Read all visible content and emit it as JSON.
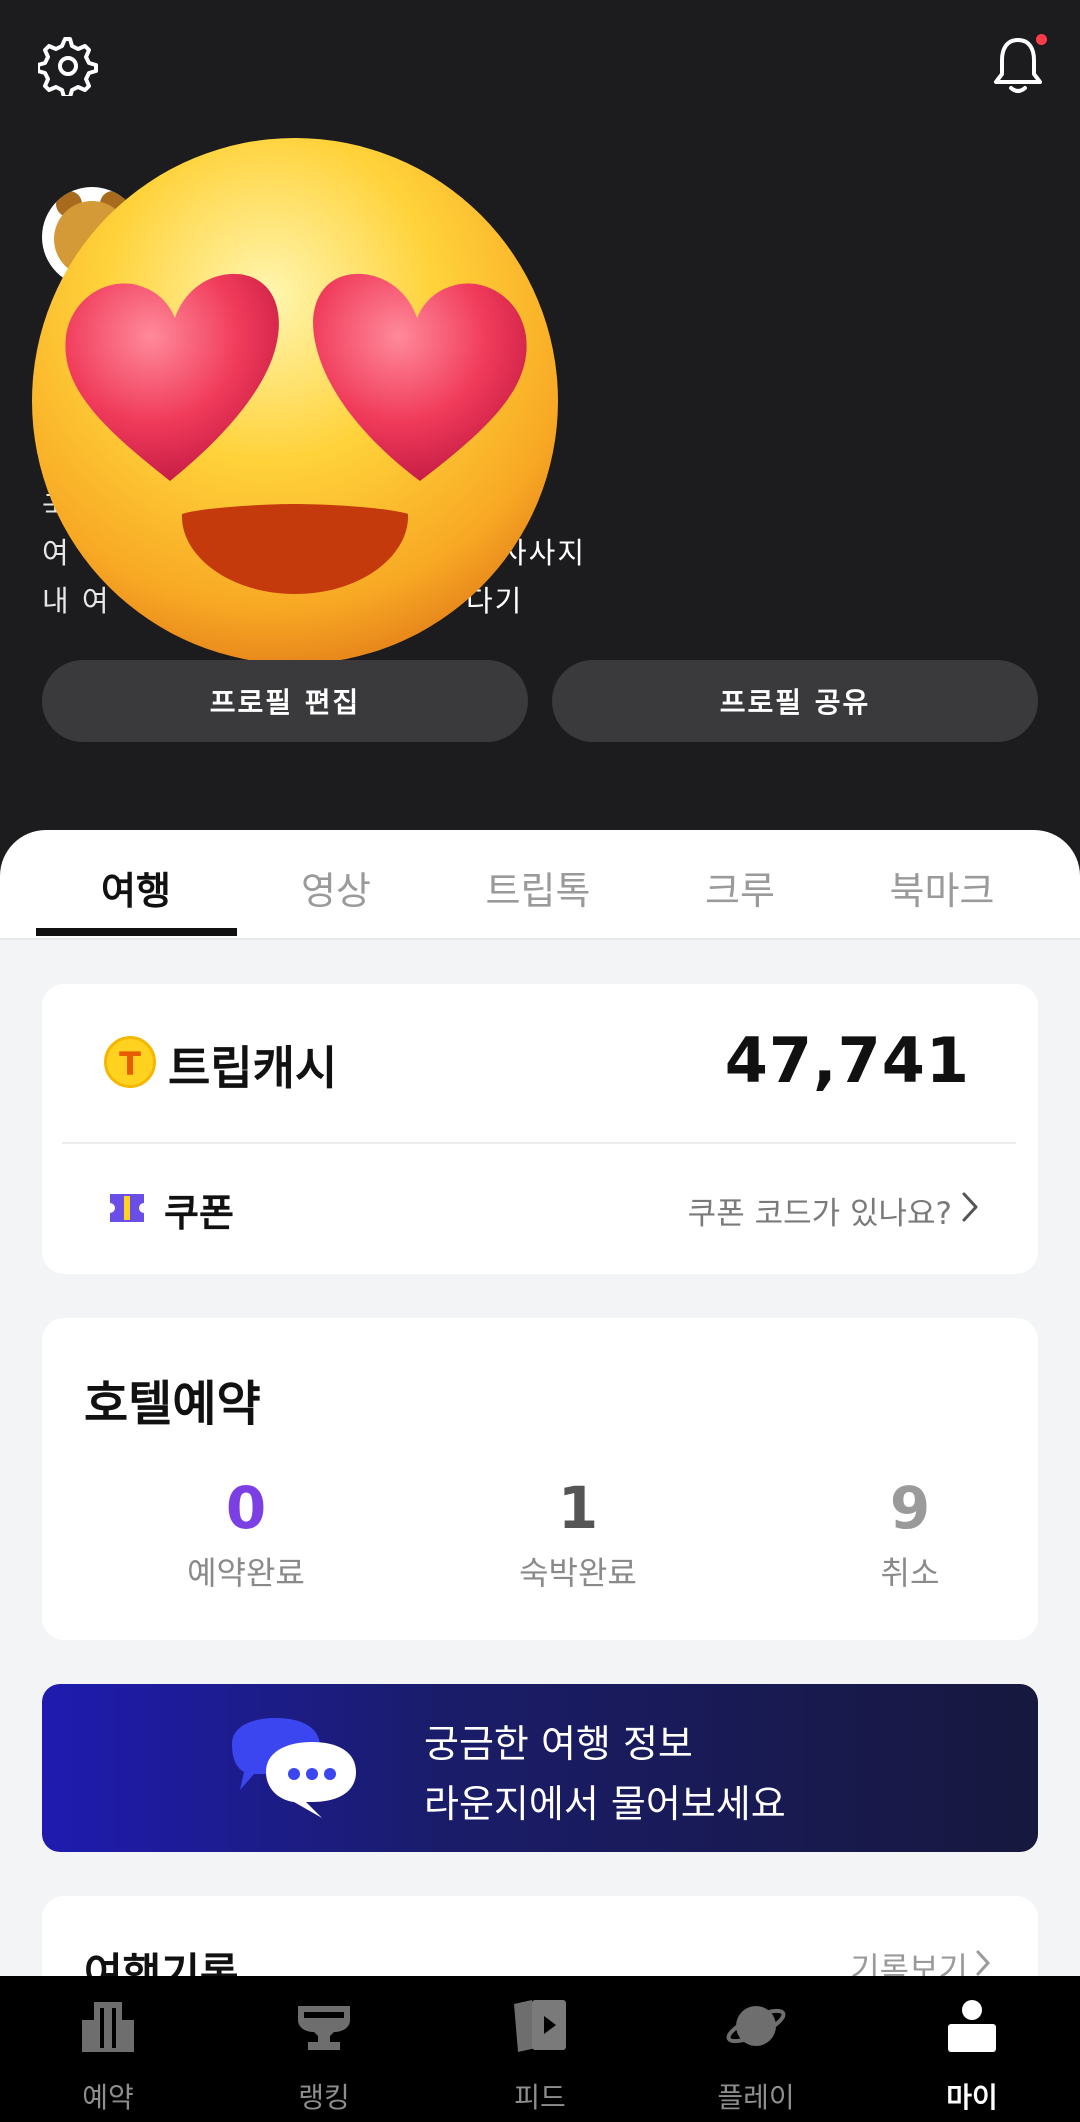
{
  "profile": {
    "bio_line1": "국",
    "bio_line2": "여",
    "bio_line2_tail": "사사지",
    "bio_line3": "내 여",
    "bio_line3_tail": "다기",
    "edit_button": "프로필 편집",
    "share_button": "프로필 공유"
  },
  "tabs": [
    {
      "label": "여행",
      "active": true
    },
    {
      "label": "영상",
      "active": false
    },
    {
      "label": "트립톡",
      "active": false
    },
    {
      "label": "크루",
      "active": false
    },
    {
      "label": "북마크",
      "active": false
    }
  ],
  "tripcash": {
    "coin_letter": "T",
    "label": "트립캐시",
    "value": "47,741"
  },
  "coupon": {
    "label": "쿠폰",
    "link_text": "쿠폰 코드가 있나요?"
  },
  "hotel": {
    "title": "호텔예약",
    "stats": [
      {
        "value": "0",
        "label": "예약완료"
      },
      {
        "value": "1",
        "label": "숙박완료"
      },
      {
        "value": "9",
        "label": "취소"
      }
    ]
  },
  "banner": {
    "line1": "궁금한 여행 정보",
    "line2": "라운지에서 물어보세요"
  },
  "records": {
    "title": "여행기록",
    "link_text": "기록보기"
  },
  "bottom_nav": [
    {
      "label": "예약",
      "icon": "building-icon",
      "active": false
    },
    {
      "label": "랭킹",
      "icon": "trophy-icon",
      "active": false
    },
    {
      "label": "피드",
      "icon": "feed-play-icon",
      "active": false
    },
    {
      "label": "플레이",
      "icon": "planet-icon",
      "active": false
    },
    {
      "label": "마이",
      "icon": "person-icon",
      "active": true
    }
  ],
  "colors": {
    "header_bg": "#1c1c1e",
    "accent_purple": "#7b3fe4",
    "coin_yellow": "#ffd21f",
    "banner_blue": "#1f1bb0"
  }
}
